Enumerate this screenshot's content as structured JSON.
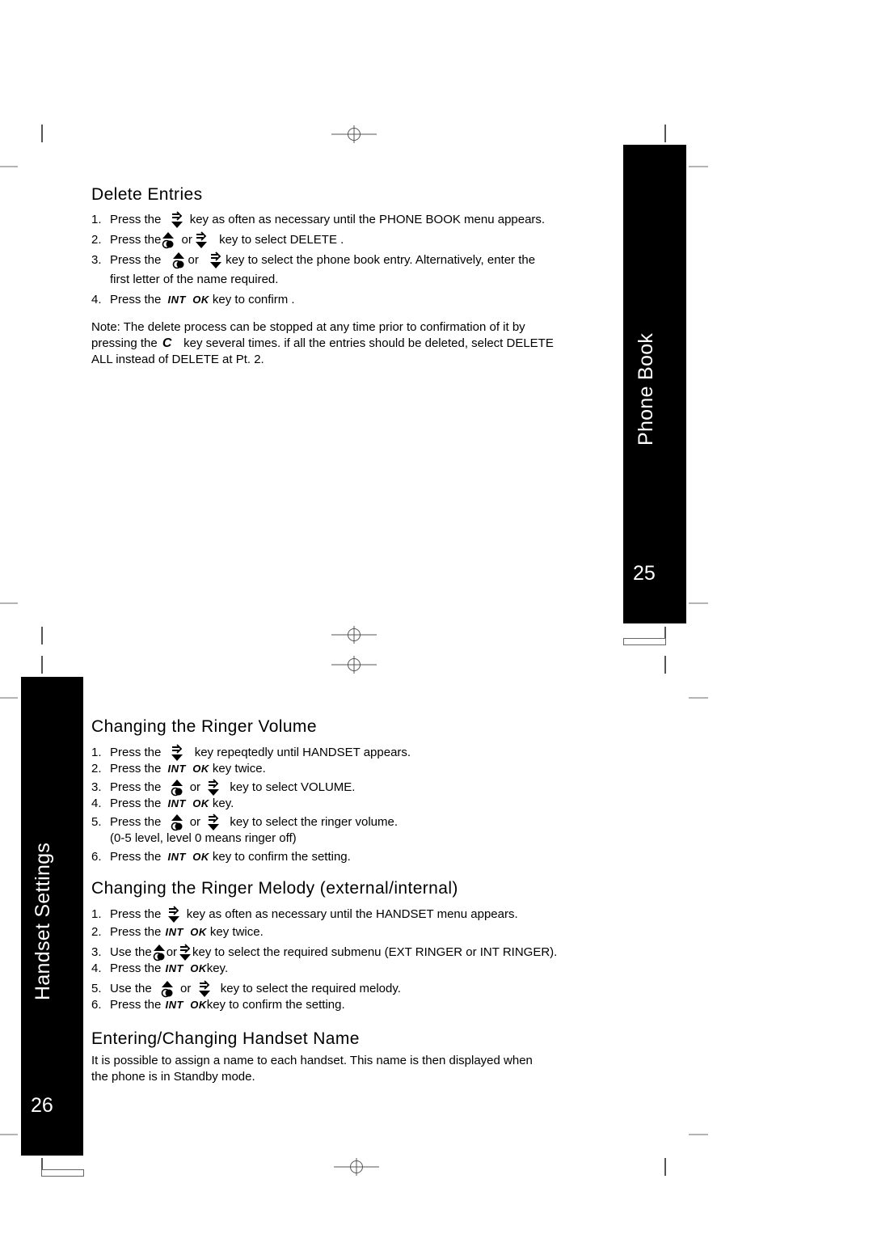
{
  "page_top": {
    "tab": {
      "title": "Phone Book",
      "page_number": "25"
    },
    "section": {
      "title": "Delete Entries",
      "steps": [
        {
          "num": "1.",
          "pre": "Press the",
          "mid": "",
          "post": "key as often as necessary until the PHONE BOOK menu appears.",
          "icons": [
            "menu-arrow-icon"
          ]
        },
        {
          "num": "2.",
          "pre": "Press the",
          "mid": "or",
          "post": "key to select DELETE .",
          "icons": [
            "up-phonebook-icon",
            "menu-arrow-icon"
          ]
        },
        {
          "num": "3.",
          "pre": "Press the",
          "mid": "or",
          "post": "key to select the phone book entry. Alternatively, enter the",
          "cont": "first letter of the name required.",
          "icons": [
            "up-phonebook-icon",
            "menu-arrow-icon"
          ]
        },
        {
          "num": "4.",
          "pre": "Press the",
          "key": "INT  OK",
          "post": "key to confirm ."
        }
      ],
      "note": {
        "line1": "Note: The delete process can be stopped at any time prior to confirmation of it by",
        "line2_pre": "pressing the",
        "line2_key": "C",
        "line2_post": "key several times. if all the entries should be deleted, select DELETE",
        "line3": "ALL instead of DELETE at Pt. 2."
      }
    }
  },
  "page_bottom": {
    "tab": {
      "title": "Handset Settings",
      "page_number": "26"
    },
    "ringer_volume": {
      "title": "Changing the Ringer Volume",
      "steps": [
        {
          "num": "1.",
          "pre": "Press the",
          "post": "key repeqtedly until HANDSET appears."
        },
        {
          "num": "2.",
          "pre": "Press the",
          "key": "INT  OK",
          "post": "key twice."
        },
        {
          "num": "3.",
          "pre": "Press the",
          "mid": "or",
          "post": "key to select VOLUME."
        },
        {
          "num": "4.",
          "pre": "Press the",
          "key": "INT  OK",
          "post": "key."
        },
        {
          "num": "5.",
          "pre": "Press the",
          "mid": "or",
          "post": "key to select the ringer volume.",
          "cont": "(0-5 level, level 0 means ringer off)"
        },
        {
          "num": "6.",
          "pre": "Press the",
          "key": "INT  OK",
          "post": "key to confirm the setting."
        }
      ]
    },
    "ringer_melody": {
      "title": "Changing the Ringer Melody (external/internal)",
      "steps": [
        {
          "num": "1.",
          "pre": "Press the",
          "post": "key as often as necessary until the HANDSET menu appears."
        },
        {
          "num": "2.",
          "pre": "Press the",
          "key": "INT  OK",
          "post": "key twice."
        },
        {
          "num": "3.",
          "pre": "Use the",
          "mid": "or",
          "post": "key to select the required submenu (EXT RINGER or INT RINGER)."
        },
        {
          "num": "4.",
          "pre": "Press the",
          "key": "INT  OK",
          "post": "key."
        },
        {
          "num": "5.",
          "pre": "Use the",
          "mid": "or",
          "post": "key to select the required melody."
        },
        {
          "num": "6.",
          "pre": "Press the",
          "key": "INT  OK",
          "post": "key to confirm the setting."
        }
      ]
    },
    "handset_name": {
      "title": "Entering/Changing Handset Name",
      "line1": "It is possible to assign a name to each handset. This name is then displayed when",
      "line2": "the phone is in Standby mode."
    }
  }
}
